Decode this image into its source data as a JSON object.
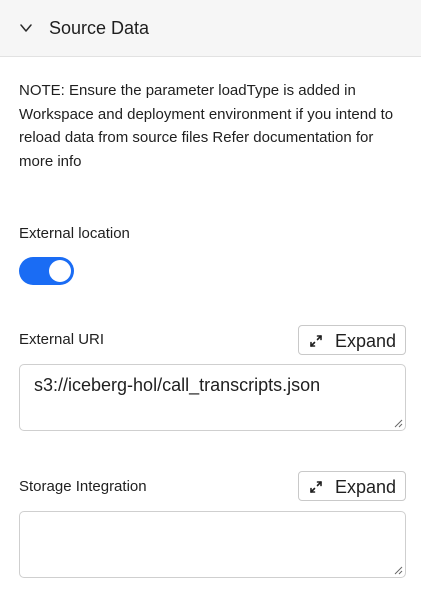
{
  "section": {
    "title": "Source Data",
    "expanded": true
  },
  "note": "NOTE: Ensure the parameter loadType is added in Workspace and deployment environment if you intend to reload data from source files Refer documentation for more info",
  "external_location": {
    "label": "External location",
    "enabled": true
  },
  "external_uri": {
    "label": "External URI",
    "expand_label": "Expand",
    "value": "s3://iceberg-hol/call_transcripts.json"
  },
  "storage_integration": {
    "label": "Storage Integration",
    "expand_label": "Expand",
    "value": ""
  },
  "colors": {
    "accent": "#1a6cf4",
    "header_bg": "#f6f6f6",
    "border": "#cfcfcf"
  },
  "icons": {
    "collapse": "chevron-down-icon",
    "expand": "expand-arrows-icon",
    "resize": "resize-grip-icon"
  }
}
